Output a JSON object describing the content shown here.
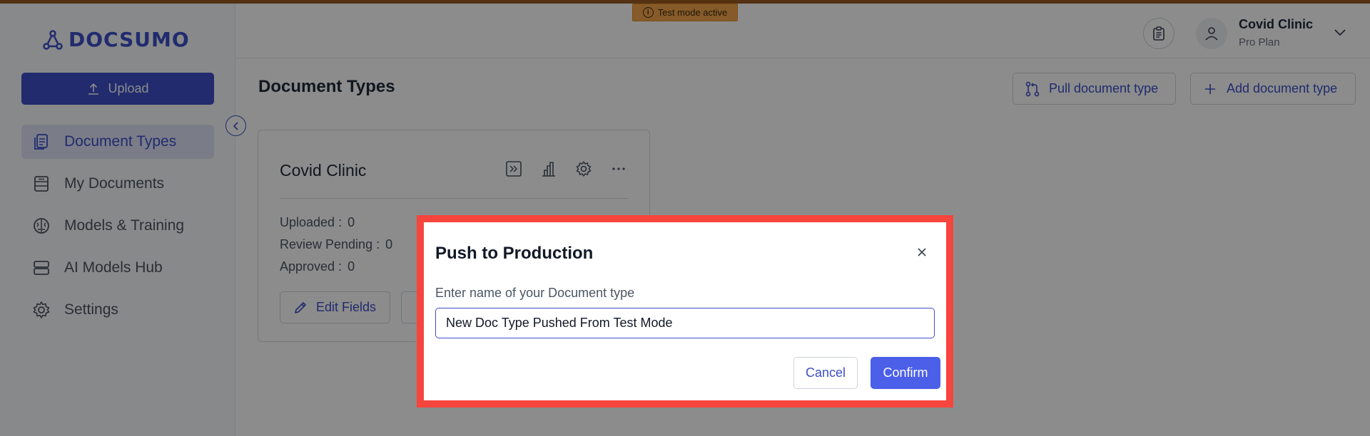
{
  "app": {
    "brand": "DOCSUMO",
    "test_badge": "Test mode active"
  },
  "sidebar": {
    "upload_label": "Upload",
    "items": [
      {
        "label": "Document Types",
        "icon": "document-types-icon",
        "active": true
      },
      {
        "label": "My Documents",
        "icon": "my-documents-icon",
        "active": false
      },
      {
        "label": "Models & Training",
        "icon": "brain-icon",
        "active": false
      },
      {
        "label": "AI Models Hub",
        "icon": "server-icon",
        "active": false
      },
      {
        "label": "Settings",
        "icon": "gear-icon",
        "active": false
      }
    ]
  },
  "header": {
    "user_name": "Covid Clinic",
    "user_plan": "Pro Plan"
  },
  "main": {
    "title": "Document Types",
    "pull_button": "Pull document type",
    "add_button": "Add document type",
    "card": {
      "title": "Covid Clinic",
      "stats": [
        {
          "label": "Uploaded :",
          "value": "0"
        },
        {
          "label": "Review Pending :",
          "value": "0"
        },
        {
          "label": "Approved :",
          "value": "0"
        }
      ],
      "edit_button": "Edit Fields"
    }
  },
  "modal": {
    "title": "Push to Production",
    "label": "Enter name of your Document type",
    "input_value": "New Doc Type Pushed From Test Mode",
    "cancel": "Cancel",
    "confirm": "Confirm"
  },
  "colors": {
    "primary": "#3d4fc8",
    "confirm": "#4c5fe8",
    "highlight_border": "#f5453d",
    "test_badge": "#f4a74c"
  }
}
